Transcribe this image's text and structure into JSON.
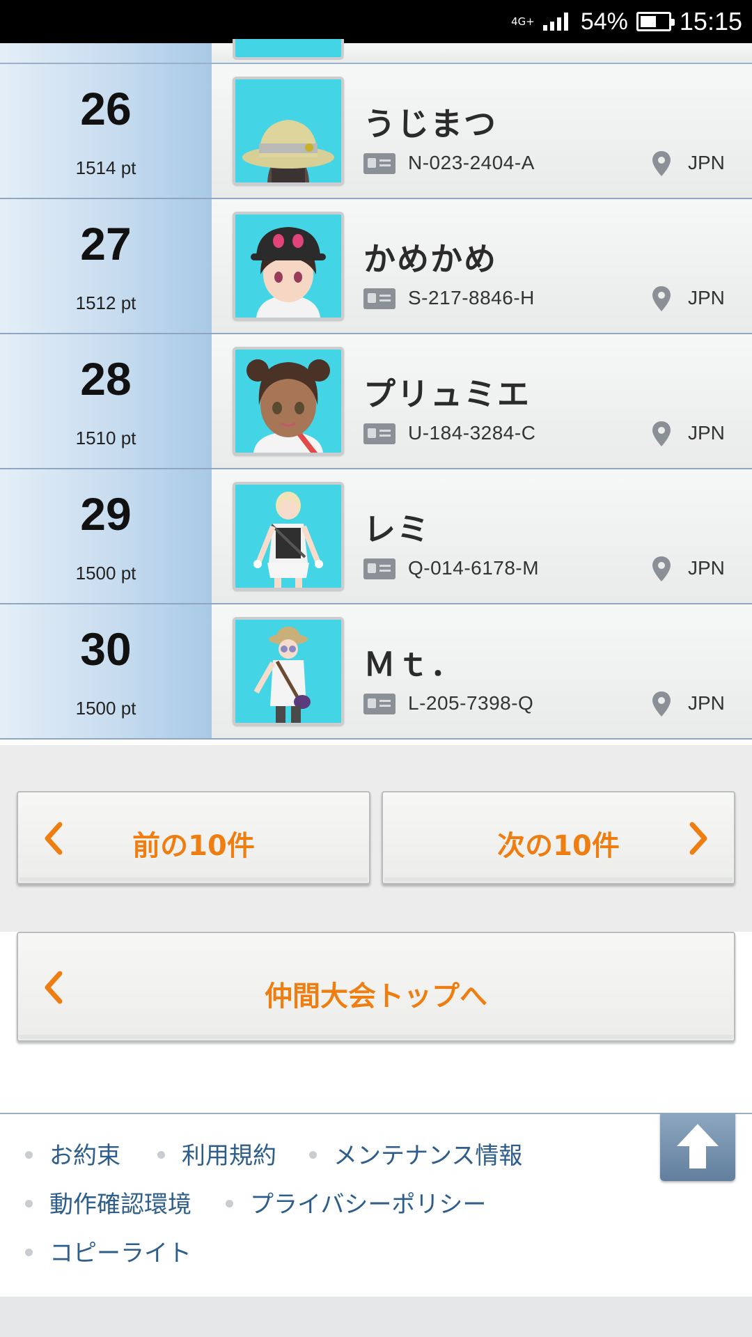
{
  "status_bar": {
    "network": "4G+",
    "battery_percent": "54%",
    "battery_level": 0.54,
    "time": "15:15"
  },
  "ranking": {
    "rows": [
      {
        "rank": "26",
        "points": "1514 pt",
        "name": "うじまつ",
        "trainer_id": "N-023-2404-A",
        "region": "JPN"
      },
      {
        "rank": "27",
        "points": "1512 pt",
        "name": "かめかめ",
        "trainer_id": "S-217-8846-H",
        "region": "JPN"
      },
      {
        "rank": "28",
        "points": "1510 pt",
        "name": "プリュミエ",
        "trainer_id": "U-184-3284-C",
        "region": "JPN"
      },
      {
        "rank": "29",
        "points": "1500 pt",
        "name": "レミ",
        "trainer_id": "Q-014-6178-M",
        "region": "JPN"
      },
      {
        "rank": "30",
        "points": "1500 pt",
        "name": "Ｍｔ．",
        "trainer_id": "L-205-7398-Q",
        "region": "JPN"
      }
    ]
  },
  "pager": {
    "prev_label": "前の10件",
    "next_label": "次の10件"
  },
  "top_button": {
    "label": "仲間大会トップへ"
  },
  "footer": {
    "links": [
      "お約束",
      "利用規約",
      "メンテナンス情報",
      "動作確認環境",
      "プライバシーポリシー",
      "コピーライト"
    ]
  },
  "colors": {
    "accent_orange": "#ef7e12",
    "link_blue": "#2d5d8a",
    "avatar_bg": "#43d5e5"
  }
}
